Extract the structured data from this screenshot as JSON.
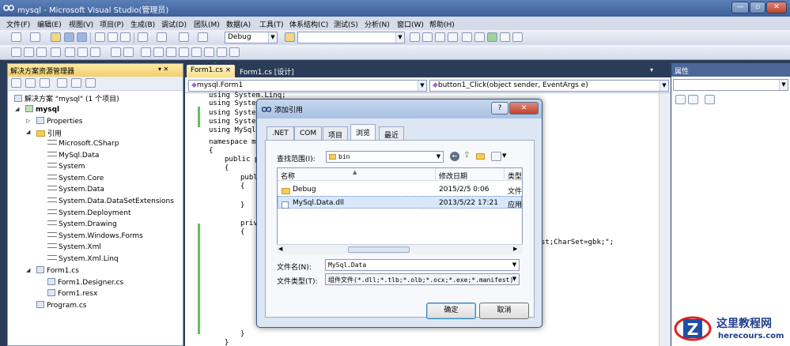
{
  "window": {
    "title": "mysql - Microsoft Visual Studio(管理员)",
    "min": "—",
    "max": "▫",
    "close": "✕"
  },
  "menu": [
    "文件(F)",
    "编辑(E)",
    "视图(V)",
    "项目(P)",
    "生成(B)",
    "调试(D)",
    "团队(M)",
    "数据(A)",
    "工具(T)",
    "体系结构(C)",
    "测试(S)",
    "分析(N)",
    "窗口(W)",
    "帮助(H)"
  ],
  "toolbar": {
    "config": "Debug",
    "search": ""
  },
  "solution_explorer": {
    "title": "解决方案资源管理器",
    "pin": "▾ ✕",
    "solution": "解决方案 \"mysql\" (1 个项目)",
    "project": "mysql",
    "properties": "Properties",
    "references_folder": "引用",
    "references": [
      "Microsoft.CSharp",
      "MySql.Data",
      "System",
      "System.Core",
      "System.Data",
      "System.Data.DataSetExtensions",
      "System.Deployment",
      "System.Drawing",
      "System.Windows.Forms",
      "System.Xml",
      "System.Xml.Linq"
    ],
    "form": "Form1.cs",
    "form_children": [
      "Form1.Designer.cs",
      "Form1.resx"
    ],
    "program": "Program.cs"
  },
  "editor": {
    "tabs": [
      "Form1.cs",
      "Form1.cs [设计]"
    ],
    "tab_close": "×",
    "class_combo": "mysql.Form1",
    "member_combo": "button1_Click(object sender, EventArgs e)",
    "lines": [
      "using System.Linq;",
      "using System",
      "using System",
      "using System",
      "using MySql.",
      "namespace mys",
      "{",
      "public p",
      "{",
      "publ",
      "{",
      "}",
      "priv",
      "{",
      "st;CharSet=gbk;\";",
      "}",
      "}"
    ]
  },
  "properties_panel": {
    "title": "属性"
  },
  "dialog": {
    "title": "添加引用",
    "help": "?",
    "close": "✕",
    "tabs": [
      ".NET",
      "COM",
      "项目",
      "浏览",
      "最近"
    ],
    "lookin_label": "查找范围(I):",
    "lookin_value": "bin",
    "columns": [
      "名称",
      "修改日期",
      "类型"
    ],
    "files": [
      {
        "name": "Debug",
        "date": "2015/2/5 0:06",
        "type": "文件"
      },
      {
        "name": "MySql.Data.dll",
        "date": "2013/5/22 17:21",
        "type": "应用"
      }
    ],
    "filename_label": "文件名(N):",
    "filename_value": "MySql.Data",
    "filetype_label": "文件类型(T):",
    "filetype_value": "组件文件(*.dll;*.tlb;*.olb;*.ocx;*.exe;*.manifest)",
    "ok": "确定",
    "cancel": "取消"
  },
  "watermark": {
    "site_cn": "这里教程网",
    "site_en": "herecours.com"
  }
}
